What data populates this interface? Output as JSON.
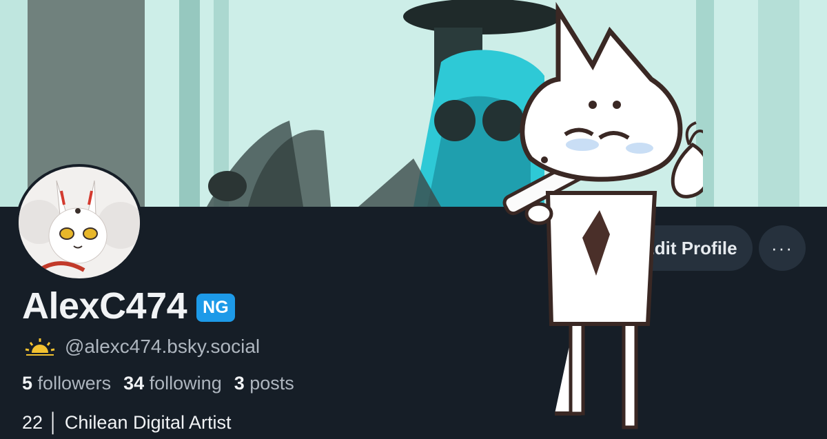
{
  "profile": {
    "display_name": "AlexC474",
    "badge": "NG",
    "handle": "@alexc474.bsky.social",
    "handle_icon": "sun-icon",
    "bio": "22 │ Chilean Digital Artist"
  },
  "stats": {
    "followers_count": "5",
    "followers_label": "followers",
    "following_count": "34",
    "following_label": "following",
    "posts_count": "3",
    "posts_label": "posts"
  },
  "actions": {
    "edit_label": "Edit Profile",
    "more_label": "···"
  },
  "colors": {
    "background": "#161e27",
    "badge": "#1d9ae8",
    "button": "#26313d",
    "muted_text": "#aeb6bf",
    "banner_teal": "#2ec9d6",
    "sun": "#f2c230"
  }
}
